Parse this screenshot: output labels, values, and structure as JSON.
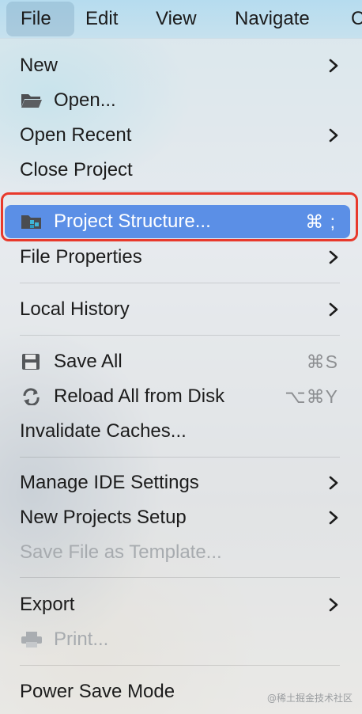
{
  "menubar": {
    "items": [
      {
        "label": "File",
        "active": true
      },
      {
        "label": "Edit"
      },
      {
        "label": "View"
      },
      {
        "label": "Navigate"
      },
      {
        "label": "C"
      }
    ]
  },
  "menu": {
    "new": {
      "label": "New",
      "submenu": true
    },
    "open": {
      "label": "Open...",
      "icon": "folder-open-icon"
    },
    "open_recent": {
      "label": "Open Recent",
      "submenu": true
    },
    "close_project": {
      "label": "Close Project"
    },
    "project_structure": {
      "label": "Project Structure...",
      "icon": "project-structure-icon",
      "shortcut": "⌘ ;",
      "selected": true
    },
    "file_properties": {
      "label": "File Properties",
      "submenu": true
    },
    "local_history": {
      "label": "Local History",
      "submenu": true
    },
    "save_all": {
      "label": "Save All",
      "icon": "save-icon",
      "shortcut": "⌘S"
    },
    "reload_all": {
      "label": "Reload All from Disk",
      "icon": "reload-icon",
      "shortcut": "⌥⌘Y"
    },
    "invalidate_caches": {
      "label": "Invalidate Caches..."
    },
    "manage_ide_settings": {
      "label": "Manage IDE Settings",
      "submenu": true
    },
    "new_projects_setup": {
      "label": "New Projects Setup",
      "submenu": true
    },
    "save_file_as_template": {
      "label": "Save File as Template...",
      "disabled": true
    },
    "export": {
      "label": "Export",
      "submenu": true
    },
    "print": {
      "label": "Print...",
      "icon": "printer-icon",
      "disabled": true
    },
    "power_save_mode": {
      "label": "Power Save Mode"
    }
  },
  "colors": {
    "selection": "#5b8fe6",
    "highlight_outline": "#e8392b"
  },
  "watermark": "@稀土掘金技术社区"
}
